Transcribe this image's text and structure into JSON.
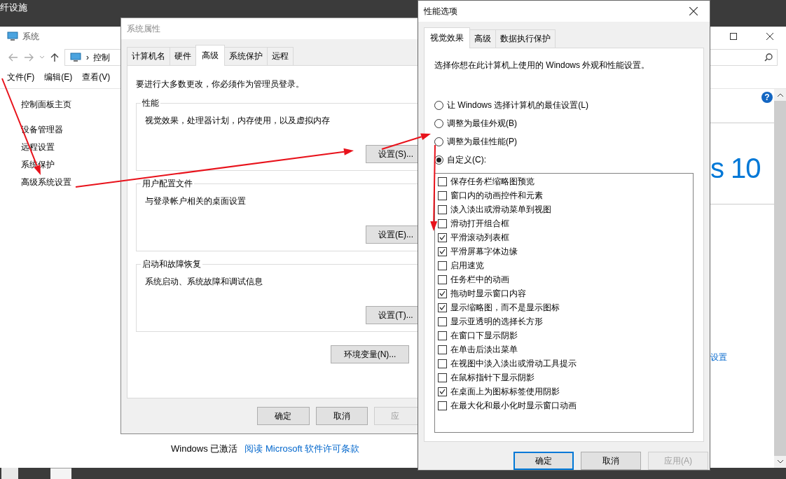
{
  "desktop": {
    "caption": "纤设施"
  },
  "system_window": {
    "title": "系统",
    "address": "控制",
    "menu": [
      "文件(F)",
      "编辑(E)",
      "查看(V)"
    ],
    "sidebar": {
      "home": "控制面板主页",
      "links": [
        "设备管理器",
        "远程设置",
        "系统保护",
        "高级系统设置"
      ]
    },
    "address_separator": "›",
    "help_glyph": "?",
    "edition_text": "s 10",
    "settings_link": "设置",
    "activation": {
      "status": "Windows 已激活",
      "link": "阅读 Microsoft 软件许可条款"
    }
  },
  "system_properties": {
    "title": "系统属性",
    "tabs": [
      {
        "label": "计算机名",
        "selected": false
      },
      {
        "label": "硬件",
        "selected": false
      },
      {
        "label": "高级",
        "selected": true
      },
      {
        "label": "系统保护",
        "selected": false
      },
      {
        "label": "远程",
        "selected": false
      }
    ],
    "notice": "要进行大多数更改，你必须作为管理员登录。",
    "groups": [
      {
        "title": "性能",
        "description": "视觉效果，处理器计划，内存使用，以及虚拟内存",
        "button": "设置(S)..."
      },
      {
        "title": "用户配置文件",
        "description": "与登录帐户相关的桌面设置",
        "button": "设置(E)..."
      },
      {
        "title": "启动和故障恢复",
        "description": "系统启动、系统故障和调试信息",
        "button": "设置(T)..."
      }
    ],
    "env_button": "环境变量(N)...",
    "buttons": [
      {
        "label": "确定",
        "disabled": false
      },
      {
        "label": "取消",
        "disabled": false
      },
      {
        "label": "应",
        "disabled": true
      }
    ]
  },
  "performance_options": {
    "title": "性能选项",
    "tabs": [
      {
        "label": "视觉效果",
        "selected": true
      },
      {
        "label": "高级",
        "selected": false
      },
      {
        "label": "数据执行保护",
        "selected": false
      }
    ],
    "description": "选择你想在此计算机上使用的 Windows 外观和性能设置。",
    "options": [
      {
        "label": "让 Windows 选择计算机的最佳设置(L)",
        "selected": false
      },
      {
        "label": "调整为最佳外观(B)",
        "selected": false
      },
      {
        "label": "调整为最佳性能(P)",
        "selected": false
      },
      {
        "label": "自定义(C):",
        "selected": true
      }
    ],
    "effects": [
      {
        "label": "保存任务栏缩略图预览",
        "checked": false
      },
      {
        "label": "窗口内的动画控件和元素",
        "checked": false
      },
      {
        "label": "淡入淡出或滑动菜单到视图",
        "checked": false
      },
      {
        "label": "滑动打开组合框",
        "checked": false
      },
      {
        "label": "平滑滚动列表框",
        "checked": true
      },
      {
        "label": "平滑屏幕字体边缘",
        "checked": true
      },
      {
        "label": "启用速览",
        "checked": false
      },
      {
        "label": "任务栏中的动画",
        "checked": false
      },
      {
        "label": "拖动时显示窗口内容",
        "checked": true
      },
      {
        "label": "显示缩略图，而不是显示图标",
        "checked": true
      },
      {
        "label": "显示亚透明的选择长方形",
        "checked": false
      },
      {
        "label": "在窗口下显示阴影",
        "checked": false
      },
      {
        "label": "在单击后淡出菜单",
        "checked": false
      },
      {
        "label": "在视图中淡入淡出或滑动工具提示",
        "checked": false
      },
      {
        "label": "在鼠标指针下显示阴影",
        "checked": false
      },
      {
        "label": "在桌面上为图标标签使用阴影",
        "checked": true
      },
      {
        "label": "在最大化和最小化时显示窗口动画",
        "checked": false
      }
    ],
    "buttons": [
      {
        "label": "确定",
        "default": true,
        "disabled": false
      },
      {
        "label": "取消",
        "default": false,
        "disabled": false
      },
      {
        "label": "应用(A)",
        "default": false,
        "disabled": true
      }
    ]
  }
}
